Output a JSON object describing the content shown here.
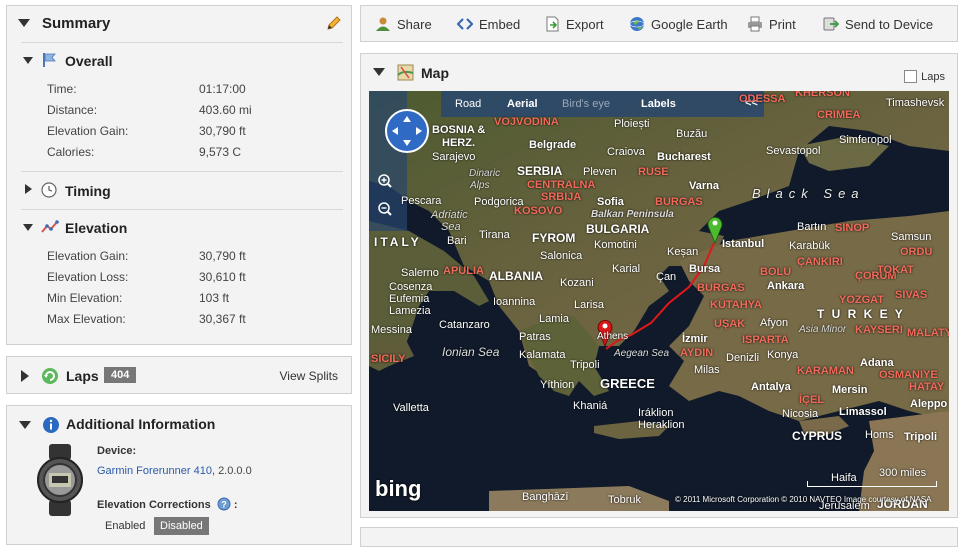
{
  "summary": {
    "title": "Summary",
    "overall": {
      "title": "Overall",
      "rows": [
        {
          "label": "Time:",
          "value": "01:17:00"
        },
        {
          "label": "Distance:",
          "value": "403.60 mi"
        },
        {
          "label": "Elevation Gain:",
          "value": "30,790 ft"
        },
        {
          "label": "Calories:",
          "value": "9,573 C"
        }
      ]
    },
    "timing": {
      "title": "Timing"
    },
    "elevation": {
      "title": "Elevation",
      "rows": [
        {
          "label": "Elevation Gain:",
          "value": "30,790 ft"
        },
        {
          "label": "Elevation Loss:",
          "value": "30,610 ft"
        },
        {
          "label": "Min Elevation:",
          "value": "103 ft"
        },
        {
          "label": "Max Elevation:",
          "value": "30,367 ft"
        }
      ]
    }
  },
  "laps": {
    "title": "Laps",
    "count": "404",
    "view_splits": "View Splits"
  },
  "additional": {
    "title": "Additional Information",
    "device_label": "Device:",
    "device_link": "Garmin Forerunner 410",
    "device_version": ", 2.0.0.0",
    "elev_corr_label": "Elevation Corrections",
    "elev_corr_colon": ":",
    "enabled": "Enabled",
    "disabled": "Disabled"
  },
  "toolbar": {
    "share": "Share",
    "embed": "Embed",
    "export": "Export",
    "google_earth": "Google Earth",
    "print": "Print",
    "send": "Send to Device"
  },
  "map": {
    "title": "Map",
    "laps_checkbox": "Laps",
    "modes": {
      "road": "Road",
      "aerial": "Aerial",
      "birdseye": "Bird's eye",
      "labels": "Labels",
      "collapse": "<<"
    },
    "scale": "300 miles",
    "logo": "bing",
    "copyright": "© 2011 Microsoft Corporation   © 2010 NAVTEQ   Image courtesy of NASA",
    "labels": {
      "odessa": "ODESSA",
      "kherson": "KHERSON",
      "timashevsk": "Timashevsk",
      "crimea": "CRIMEA",
      "sevastopol": "Sevastopol",
      "simferopol": "Simferopol",
      "bosnia": "BOSNIA &",
      "herz": "HERZ.",
      "sarajevo": "Sarajevo",
      "vojvodina": "VOJVODINA",
      "belgrade": "Belgrade",
      "serbia": "SERBIA",
      "central_serbia": "CENTRALNA",
      "srbija": "SRBIJA",
      "kosovo": "KOSOVO",
      "ploiesti": "Ploiești",
      "buzau": "Buzău",
      "craiova": "Craiova",
      "bucharest": "Bucharest",
      "ruse": "RUSE",
      "pleven": "Pleven",
      "varna": "Varna",
      "sofia": "Sofia",
      "burgas": "BURGAS",
      "balkan": "Balkan Peninsula",
      "bulgaria": "BULGARIA",
      "black_sea": "Black Sea",
      "dinaric": "Dinaric",
      "alps": "Alps",
      "podgorica": "Podgorica",
      "adriatic": "Adriatic",
      "sea": "Sea",
      "pescara": "Pescara",
      "bari": "Bari",
      "italy": "ITALY",
      "tirana": "Tirana",
      "fyrom": "FYROM",
      "komotini": "Komotini",
      "kesan": "Keșan",
      "istanbul": "Istanbul",
      "bartin": "Bartın",
      "sinop": "SINOP",
      "samsun": "Samsun",
      "karabuk": "Karabük",
      "ordu": "ORDU",
      "cankiri": "ÇANKIRI",
      "corum": "ÇORUM",
      "tokat": "TOKAT",
      "salerno": "Salerno",
      "apulia": "APULIA",
      "albania": "ALBANIA",
      "salonica": "Salonica",
      "karial": "Karial",
      "bursa": "Bursa",
      "bolu": "BOLU",
      "ankara": "Ankara",
      "sivas": "SIVAS",
      "yozgat": "YOZGAT",
      "cosenza": "Cosenza",
      "euphemia": "Eufemia",
      "lamezia": "Lamezia",
      "ioannina": "Ioannina",
      "kozani": "Kozani",
      "larisa": "Larisa",
      "canakkale": "Çan",
      "kutahya": "KÜTAHYA",
      "turkey": "T U R K E Y",
      "kayseri": "KAYSERI",
      "asia_minor": "Asia Minor",
      "messina": "Messina",
      "catanzaro": "Catanzaro",
      "lamia": "Lamia",
      "athens": "Athens",
      "izmir": "İzmir",
      "usak": "UŞAK",
      "afyon": "Afyon",
      "isparta": "ISPARTA",
      "konya": "Konya",
      "malatya": "MALATYA",
      "adana": "Adana",
      "sicily": "SICILY",
      "ionian": "Ionian Sea",
      "patras": "Patras",
      "kalamata": "Kalamata",
      "tripoli": "Tripoli",
      "aegean": "Aegean Sea",
      "aydin": "AYDIN",
      "denizli": "Denizli",
      "greece": "GREECE",
      "milas": "Milas",
      "karaman": "KARAMAN",
      "osmaniye": "OSMANIYE",
      "gythion": "Yíthion",
      "antalya": "Antalya",
      "mersin": "Mersin",
      "icel": "İÇEL",
      "hatay": "HATAY",
      "aleppo": "Aleppo",
      "valletta": "Valletta",
      "khania": "Khaniá",
      "iraklion": "Iráklion",
      "heraklion": "Heraklion",
      "nicosia": "Nicosia",
      "limassol": "Limassol",
      "cyprus": "CYPRUS",
      "homs": "Homs",
      "tripoli_leb": "Tripoli",
      "benghazi": "Banghāzī",
      "tobruk": "Tobruk",
      "haifa": "Haifa",
      "jerusalem": "Jerusalem",
      "jordan": "JORDAN"
    }
  }
}
